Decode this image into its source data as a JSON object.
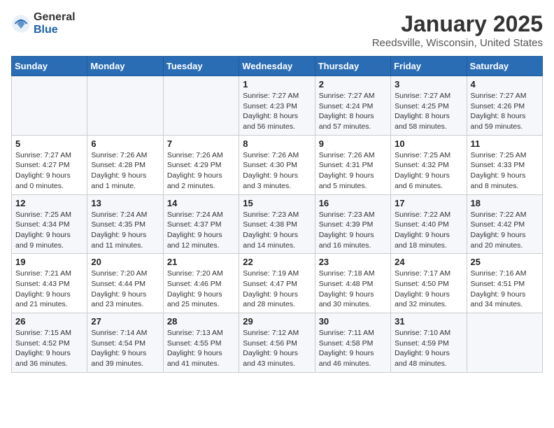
{
  "header": {
    "logo_general": "General",
    "logo_blue": "Blue",
    "month_title": "January 2025",
    "location": "Reedsville, Wisconsin, United States"
  },
  "days_of_week": [
    "Sunday",
    "Monday",
    "Tuesday",
    "Wednesday",
    "Thursday",
    "Friday",
    "Saturday"
  ],
  "weeks": [
    [
      {
        "day": "",
        "info": ""
      },
      {
        "day": "",
        "info": ""
      },
      {
        "day": "",
        "info": ""
      },
      {
        "day": "1",
        "info": "Sunrise: 7:27 AM\nSunset: 4:23 PM\nDaylight: 8 hours\nand 56 minutes."
      },
      {
        "day": "2",
        "info": "Sunrise: 7:27 AM\nSunset: 4:24 PM\nDaylight: 8 hours\nand 57 minutes."
      },
      {
        "day": "3",
        "info": "Sunrise: 7:27 AM\nSunset: 4:25 PM\nDaylight: 8 hours\nand 58 minutes."
      },
      {
        "day": "4",
        "info": "Sunrise: 7:27 AM\nSunset: 4:26 PM\nDaylight: 8 hours\nand 59 minutes."
      }
    ],
    [
      {
        "day": "5",
        "info": "Sunrise: 7:27 AM\nSunset: 4:27 PM\nDaylight: 9 hours\nand 0 minutes."
      },
      {
        "day": "6",
        "info": "Sunrise: 7:26 AM\nSunset: 4:28 PM\nDaylight: 9 hours\nand 1 minute."
      },
      {
        "day": "7",
        "info": "Sunrise: 7:26 AM\nSunset: 4:29 PM\nDaylight: 9 hours\nand 2 minutes."
      },
      {
        "day": "8",
        "info": "Sunrise: 7:26 AM\nSunset: 4:30 PM\nDaylight: 9 hours\nand 3 minutes."
      },
      {
        "day": "9",
        "info": "Sunrise: 7:26 AM\nSunset: 4:31 PM\nDaylight: 9 hours\nand 5 minutes."
      },
      {
        "day": "10",
        "info": "Sunrise: 7:25 AM\nSunset: 4:32 PM\nDaylight: 9 hours\nand 6 minutes."
      },
      {
        "day": "11",
        "info": "Sunrise: 7:25 AM\nSunset: 4:33 PM\nDaylight: 9 hours\nand 8 minutes."
      }
    ],
    [
      {
        "day": "12",
        "info": "Sunrise: 7:25 AM\nSunset: 4:34 PM\nDaylight: 9 hours\nand 9 minutes."
      },
      {
        "day": "13",
        "info": "Sunrise: 7:24 AM\nSunset: 4:35 PM\nDaylight: 9 hours\nand 11 minutes."
      },
      {
        "day": "14",
        "info": "Sunrise: 7:24 AM\nSunset: 4:37 PM\nDaylight: 9 hours\nand 12 minutes."
      },
      {
        "day": "15",
        "info": "Sunrise: 7:23 AM\nSunset: 4:38 PM\nDaylight: 9 hours\nand 14 minutes."
      },
      {
        "day": "16",
        "info": "Sunrise: 7:23 AM\nSunset: 4:39 PM\nDaylight: 9 hours\nand 16 minutes."
      },
      {
        "day": "17",
        "info": "Sunrise: 7:22 AM\nSunset: 4:40 PM\nDaylight: 9 hours\nand 18 minutes."
      },
      {
        "day": "18",
        "info": "Sunrise: 7:22 AM\nSunset: 4:42 PM\nDaylight: 9 hours\nand 20 minutes."
      }
    ],
    [
      {
        "day": "19",
        "info": "Sunrise: 7:21 AM\nSunset: 4:43 PM\nDaylight: 9 hours\nand 21 minutes."
      },
      {
        "day": "20",
        "info": "Sunrise: 7:20 AM\nSunset: 4:44 PM\nDaylight: 9 hours\nand 23 minutes."
      },
      {
        "day": "21",
        "info": "Sunrise: 7:20 AM\nSunset: 4:46 PM\nDaylight: 9 hours\nand 25 minutes."
      },
      {
        "day": "22",
        "info": "Sunrise: 7:19 AM\nSunset: 4:47 PM\nDaylight: 9 hours\nand 28 minutes."
      },
      {
        "day": "23",
        "info": "Sunrise: 7:18 AM\nSunset: 4:48 PM\nDaylight: 9 hours\nand 30 minutes."
      },
      {
        "day": "24",
        "info": "Sunrise: 7:17 AM\nSunset: 4:50 PM\nDaylight: 9 hours\nand 32 minutes."
      },
      {
        "day": "25",
        "info": "Sunrise: 7:16 AM\nSunset: 4:51 PM\nDaylight: 9 hours\nand 34 minutes."
      }
    ],
    [
      {
        "day": "26",
        "info": "Sunrise: 7:15 AM\nSunset: 4:52 PM\nDaylight: 9 hours\nand 36 minutes."
      },
      {
        "day": "27",
        "info": "Sunrise: 7:14 AM\nSunset: 4:54 PM\nDaylight: 9 hours\nand 39 minutes."
      },
      {
        "day": "28",
        "info": "Sunrise: 7:13 AM\nSunset: 4:55 PM\nDaylight: 9 hours\nand 41 minutes."
      },
      {
        "day": "29",
        "info": "Sunrise: 7:12 AM\nSunset: 4:56 PM\nDaylight: 9 hours\nand 43 minutes."
      },
      {
        "day": "30",
        "info": "Sunrise: 7:11 AM\nSunset: 4:58 PM\nDaylight: 9 hours\nand 46 minutes."
      },
      {
        "day": "31",
        "info": "Sunrise: 7:10 AM\nSunset: 4:59 PM\nDaylight: 9 hours\nand 48 minutes."
      },
      {
        "day": "",
        "info": ""
      }
    ]
  ]
}
